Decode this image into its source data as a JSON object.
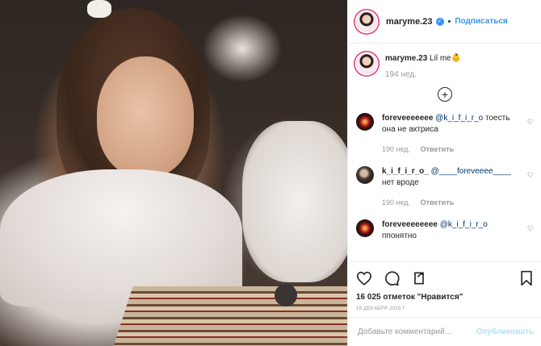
{
  "header": {
    "username": "maryme.23",
    "follow": "Подписаться",
    "separator": "•"
  },
  "caption": {
    "username": "maryme.23",
    "text": "Lil me",
    "emoji": "👶",
    "time": "194 нед."
  },
  "load_more_icon": "plus-circle-icon",
  "comments": [
    {
      "username": "foreveeeeeee",
      "mention": "@k_i_f_i_r_o",
      "text": "тоесть она не актриса",
      "time": "190 нед.",
      "reply": "Ответить",
      "avatar": "firework"
    },
    {
      "username": "k_i_f_i_r_o_",
      "mention": "@____foreveeee____",
      "text": "нет вроде",
      "time": "190 нед.",
      "reply": "Ответить",
      "avatar": "portrait"
    },
    {
      "username": "foreveeeeeeee",
      "mention": "@k_i_f_i_r_o",
      "text": "ппонятно",
      "time": "",
      "reply": "",
      "avatar": "firework"
    }
  ],
  "actions": {
    "icons": [
      "heart-icon",
      "comment-icon",
      "share-icon",
      "bookmark-icon"
    ],
    "likes": "16 025 отметок \"Нравится\"",
    "date": "18 ДЕКАБРЯ 2015 Г."
  },
  "add_comment": {
    "placeholder": "Добавьте комментарий...",
    "button": "Опубликовать"
  },
  "colors": {
    "accent": "#3897f0",
    "text": "#262626",
    "muted": "#999999",
    "ring": "#e13b7a"
  }
}
